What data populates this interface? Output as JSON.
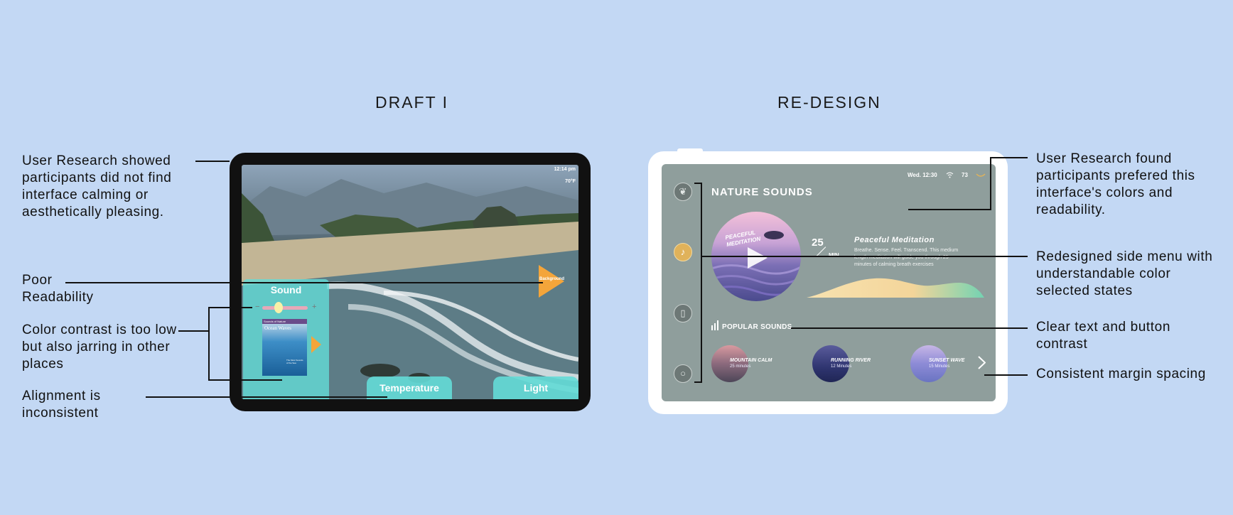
{
  "headings": {
    "draft": "DRAFT I",
    "redesign": "RE-DESIGN"
  },
  "left_notes": [
    "User Research showed participants did not find interface calming or aesthetically pleasing.",
    "Poor Readability",
    "Color contrast is too low but also jarring in other places",
    "Alignment is inconsistent"
  ],
  "right_notes": [
    "User Research found participants prefered this interface's colors and readability.",
    "Redesigned side menu with understandable color selected states",
    "Clear text and button contrast",
    "Consistent margin spacing"
  ],
  "draft": {
    "time": "12:14 pm",
    "temp": "70°F",
    "background_label": "Background",
    "sound_label": "Sound",
    "minus": "−",
    "plus": "+",
    "album_header": "Sounds of Nature",
    "album_title": "Ocean Waves",
    "album_sub": "The Most Sounds of the Sea",
    "temperature_label": "Temperature",
    "light_label": "Light",
    "colors": {
      "panel": "#5fdcd4",
      "accent": "#f4a53a"
    }
  },
  "redesign": {
    "status_date": "Wed. 12:30",
    "status_temp": "73",
    "page_title": "NATURE SOUNDS",
    "art_text": "PEACEFUL MEDITATION",
    "duration_number": "25",
    "duration_unit": "MIN",
    "track_title": "Peaceful Meditation",
    "track_desc": "Breathe. Sense. Feel. Transcend. This medium length meditation will guide you through 25 minutes of calming breath exercises",
    "popular_label": "POPULAR SOUNDS",
    "sounds": [
      {
        "name": "MOUNTAIN CALM",
        "duration": "25 minutes"
      },
      {
        "name": "RUNNING RIVER",
        "duration": "12 Minutes"
      },
      {
        "name": "SUNSET WAVE",
        "duration": "15 Minutes"
      }
    ],
    "icons": [
      "leaf-icon",
      "music-note-icon",
      "thermometer-icon",
      "lightbulb-icon",
      "wifi-icon",
      "chevron-right-icon",
      "play-icon"
    ],
    "colors": {
      "screen": "#8f9e9c",
      "selected": "#e0b25a"
    }
  }
}
